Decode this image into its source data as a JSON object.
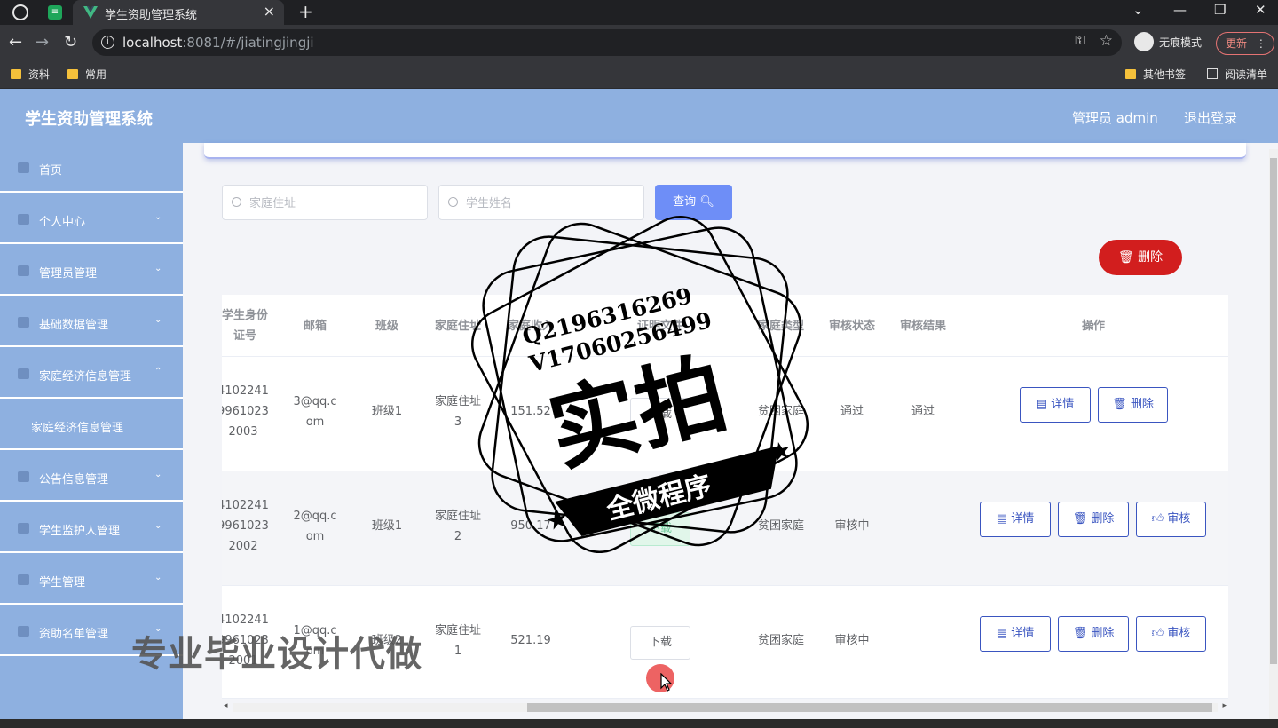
{
  "browser": {
    "tab_title": "学生资助管理系统",
    "url_host": "localhost",
    "url_rest": ":8081/#/jiatingjingji",
    "incognito_label": "无痕模式",
    "update_label": "更新",
    "bookmarks": [
      "资料",
      "常用"
    ],
    "bookmarks_right": [
      "其他书签",
      "阅读清单"
    ]
  },
  "app": {
    "title": "学生资助管理系统",
    "user": "管理员 admin",
    "logout": "退出登录"
  },
  "sidebar": {
    "items": [
      {
        "label": "首页"
      },
      {
        "label": "个人中心"
      },
      {
        "label": "管理员管理"
      },
      {
        "label": "基础数据管理"
      },
      {
        "label": "家庭经济信息管理"
      },
      {
        "label": "家庭经济信息管理"
      },
      {
        "label": "公告信息管理"
      },
      {
        "label": "学生监护人管理"
      },
      {
        "label": "学生管理"
      },
      {
        "label": "资助名单管理"
      }
    ]
  },
  "search": {
    "address_placeholder": "家庭住址",
    "name_placeholder": "学生姓名",
    "query_label": "查询"
  },
  "toolbar": {
    "delete_label": "删除"
  },
  "table": {
    "headers": [
      "学生身份\n证号",
      "邮箱",
      "班级",
      "家庭住址",
      "家庭收入",
      "证明文件",
      "家庭类型",
      "审核状态",
      "审核结果",
      "操作"
    ],
    "rows": [
      {
        "id": "4102241\n9961023\n2003",
        "email": "3@qq.c\nom",
        "class": "班级1",
        "address": "家庭住址\n3",
        "income": "151.52",
        "file": "下载",
        "type": "贫困家庭",
        "status": "通过",
        "result": "通过"
      },
      {
        "id": "4102241\n9961023\n2002",
        "email": "2@qq.c\nom",
        "class": "班级1",
        "address": "家庭住址\n2",
        "income": "950.17",
        "file": "下载",
        "type": "贫困家庭",
        "status": "审核中",
        "result": ""
      },
      {
        "id": "4102241\n9961023\n2001",
        "email": "1@qq.c\nom",
        "class": "班级2",
        "address": "家庭住址\n1",
        "income": "521.19",
        "file": "下载",
        "type": "贫困家庭",
        "status": "审核中",
        "result": ""
      }
    ],
    "actions": {
      "detail": "详情",
      "delete": "删除",
      "review": "审核"
    }
  },
  "overlay": {
    "stamp_qq": "Q2196316269",
    "stamp_wx": "V17060256499",
    "stamp_main": "实拍",
    "stamp_banner": "全微程序",
    "bottom_text": "专业毕业设计代做"
  }
}
